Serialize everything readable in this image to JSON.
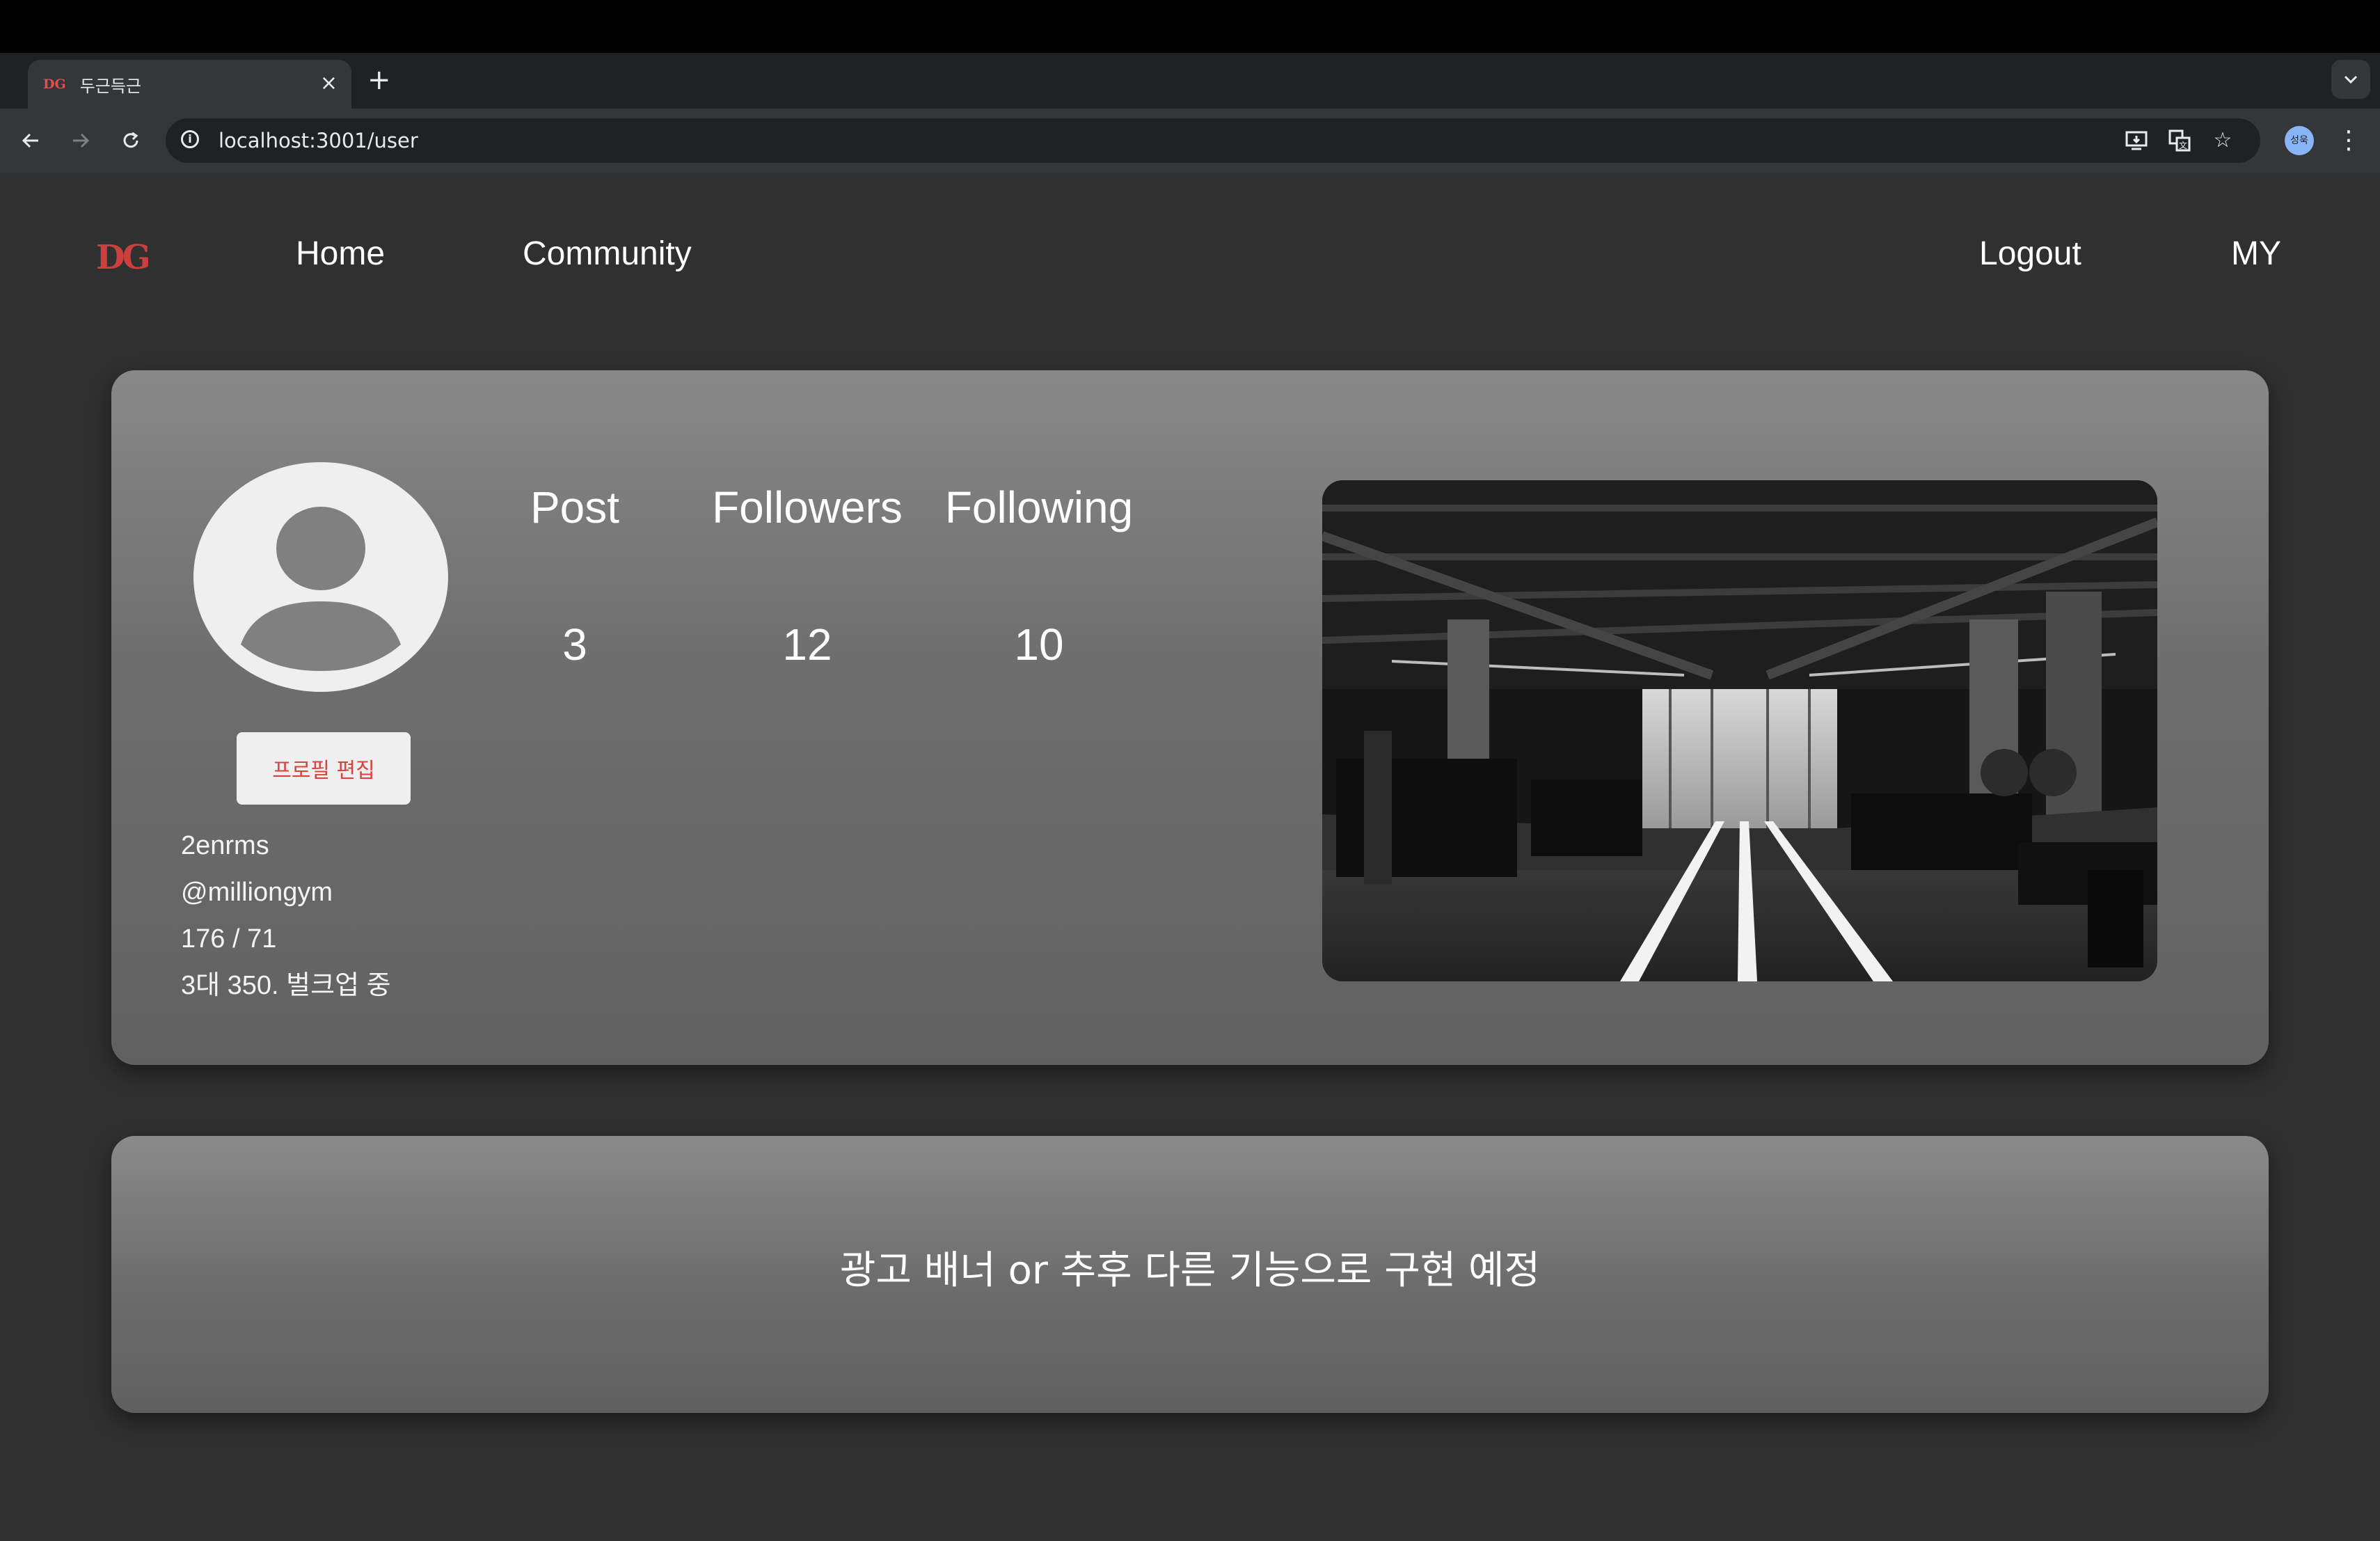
{
  "browser": {
    "tab_favicon": "DG",
    "tab_title": "두근득근",
    "tab_close": "×",
    "new_tab": "+",
    "url": "localhost:3001/user",
    "profile_initials": "성욱",
    "icons": [
      "back-icon",
      "forward-icon",
      "reload-icon",
      "site-info-icon",
      "install-app-icon",
      "translate-icon",
      "bookmark-star-icon",
      "menu-kebab-icon",
      "tab-search-chevron-icon"
    ]
  },
  "nav": {
    "logo": "DG",
    "home": "Home",
    "community": "Community",
    "logout": "Logout",
    "my": "MY"
  },
  "profile": {
    "edit_button": "프로필 편집",
    "username": "2enrms",
    "handle": "@milliongym",
    "body_stats": "176 / 71",
    "bio": "3대 350. 벌크업 중",
    "stats": {
      "post_label": "Post",
      "post_value": "3",
      "followers_label": "Followers",
      "followers_value": "12",
      "following_label": "Following",
      "following_value": "10"
    },
    "photo_description_icon": "gym-photo"
  },
  "banner": {
    "text": "광고 배너 or 추후 다른 기능으로 구현 예정"
  }
}
